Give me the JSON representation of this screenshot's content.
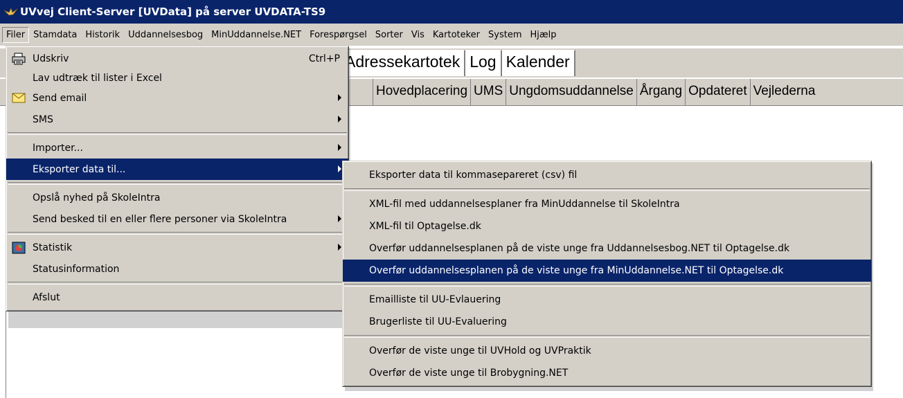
{
  "window": {
    "title": "UVvej Client-Server [UVData] på server UVDATA-TS9"
  },
  "menubar": {
    "items": [
      {
        "label": "Filer"
      },
      {
        "label": "Stamdata"
      },
      {
        "label": "Historik"
      },
      {
        "label": "Uddannelsesbog"
      },
      {
        "label": "MinUddannelse.NET"
      },
      {
        "label": "Forespørgsel"
      },
      {
        "label": "Sorter"
      },
      {
        "label": "Vis"
      },
      {
        "label": "Kartoteker"
      },
      {
        "label": "System"
      },
      {
        "label": "Hjælp"
      }
    ]
  },
  "tabs": [
    "Adressekartotek",
    "Log",
    "Kalender"
  ],
  "columns": [
    "Hovedplacering",
    "UMS",
    "Ungdomsuddannelse",
    "Årgang",
    "Opdateret",
    "Vejlederna"
  ],
  "filer_menu": {
    "items": [
      {
        "label": "Udskriv",
        "shortcut": "Ctrl+P",
        "icon": "printer-icon"
      },
      {
        "label": "Lav udtræk til lister i Excel"
      },
      {
        "label": "Send email",
        "icon": "envelope-icon"
      },
      {
        "label": "SMS"
      },
      {
        "label": "Importer..."
      },
      {
        "label": "Eksporter data til..."
      },
      {
        "label": "Opslå nyhed på SkoleIntra"
      },
      {
        "label": "Send besked til en eller flere personer via SkoleIntra"
      },
      {
        "label": "Statistik",
        "icon": "chart-icon"
      },
      {
        "label": "Statusinformation"
      },
      {
        "label": "Afslut"
      }
    ]
  },
  "export_submenu": {
    "items": [
      {
        "label": "Eksporter data til kommasepareret (csv) fil"
      },
      {
        "label": "XML-fil med uddannelsesplaner fra MinUddannelse til SkoleIntra"
      },
      {
        "label": "XML-fil til Optagelse.dk"
      },
      {
        "label": "Overfør uddannelsesplanen på de viste unge fra Uddannelsesbog.NET til Optagelse.dk"
      },
      {
        "label": "Overfør uddannelsesplanen på de viste unge fra MinUddannelse.NET til Optagelse.dk"
      },
      {
        "label": "Emailliste til UU-Evlauering"
      },
      {
        "label": "Brugerliste til UU-Evaluering"
      },
      {
        "label": "Overfør de viste unge til UVHold og UVPraktik"
      },
      {
        "label": "Overfør de viste unge til Brobygning.NET"
      }
    ]
  },
  "colors": {
    "titlebar": "#0a246a",
    "selection": "#0a246a",
    "face": "#d4d0c8"
  }
}
